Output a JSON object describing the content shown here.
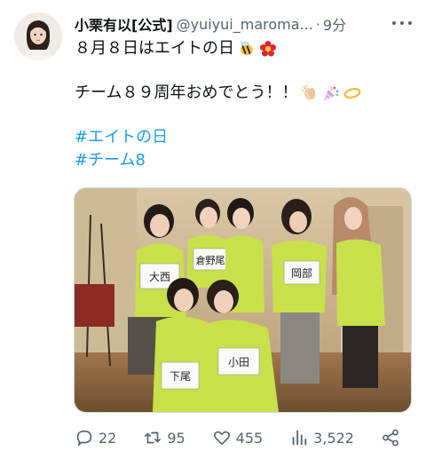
{
  "tweet": {
    "display_name": "小栗有以[公式]",
    "handle": "@yuiyui_maroma...",
    "separator": "·",
    "time": "9分",
    "text_line1": "８月８日はエイトの日",
    "text_line2": "チーム８９周年おめでとう！！",
    "hashtag1": "#エイトの日",
    "hashtag2": "#チーム8",
    "emoji_line1": [
      "bee-emoji",
      "red-flower-emoji"
    ],
    "emoji_line2": [
      "clapping-hands-emoji",
      "party-popper-emoji",
      "halo-emoji"
    ]
  },
  "photo": {
    "bib_labels": [
      "大西",
      "倉野尾",
      "岡部",
      "下尾",
      "小田"
    ]
  },
  "actions": {
    "replies": "22",
    "retweets": "95",
    "likes": "455",
    "views": "3,522"
  },
  "icons": {
    "reply": "speech-bubble-icon",
    "retweet": "retweet-icon",
    "like": "heart-icon",
    "views": "bar-chart-icon",
    "share": "share-icon",
    "more": "more-dots-icon"
  },
  "colors": {
    "hashtag": "#1d9bf0",
    "secondary_text": "#536471",
    "primary_text": "#0f1419",
    "vest": "#c8e04a"
  }
}
